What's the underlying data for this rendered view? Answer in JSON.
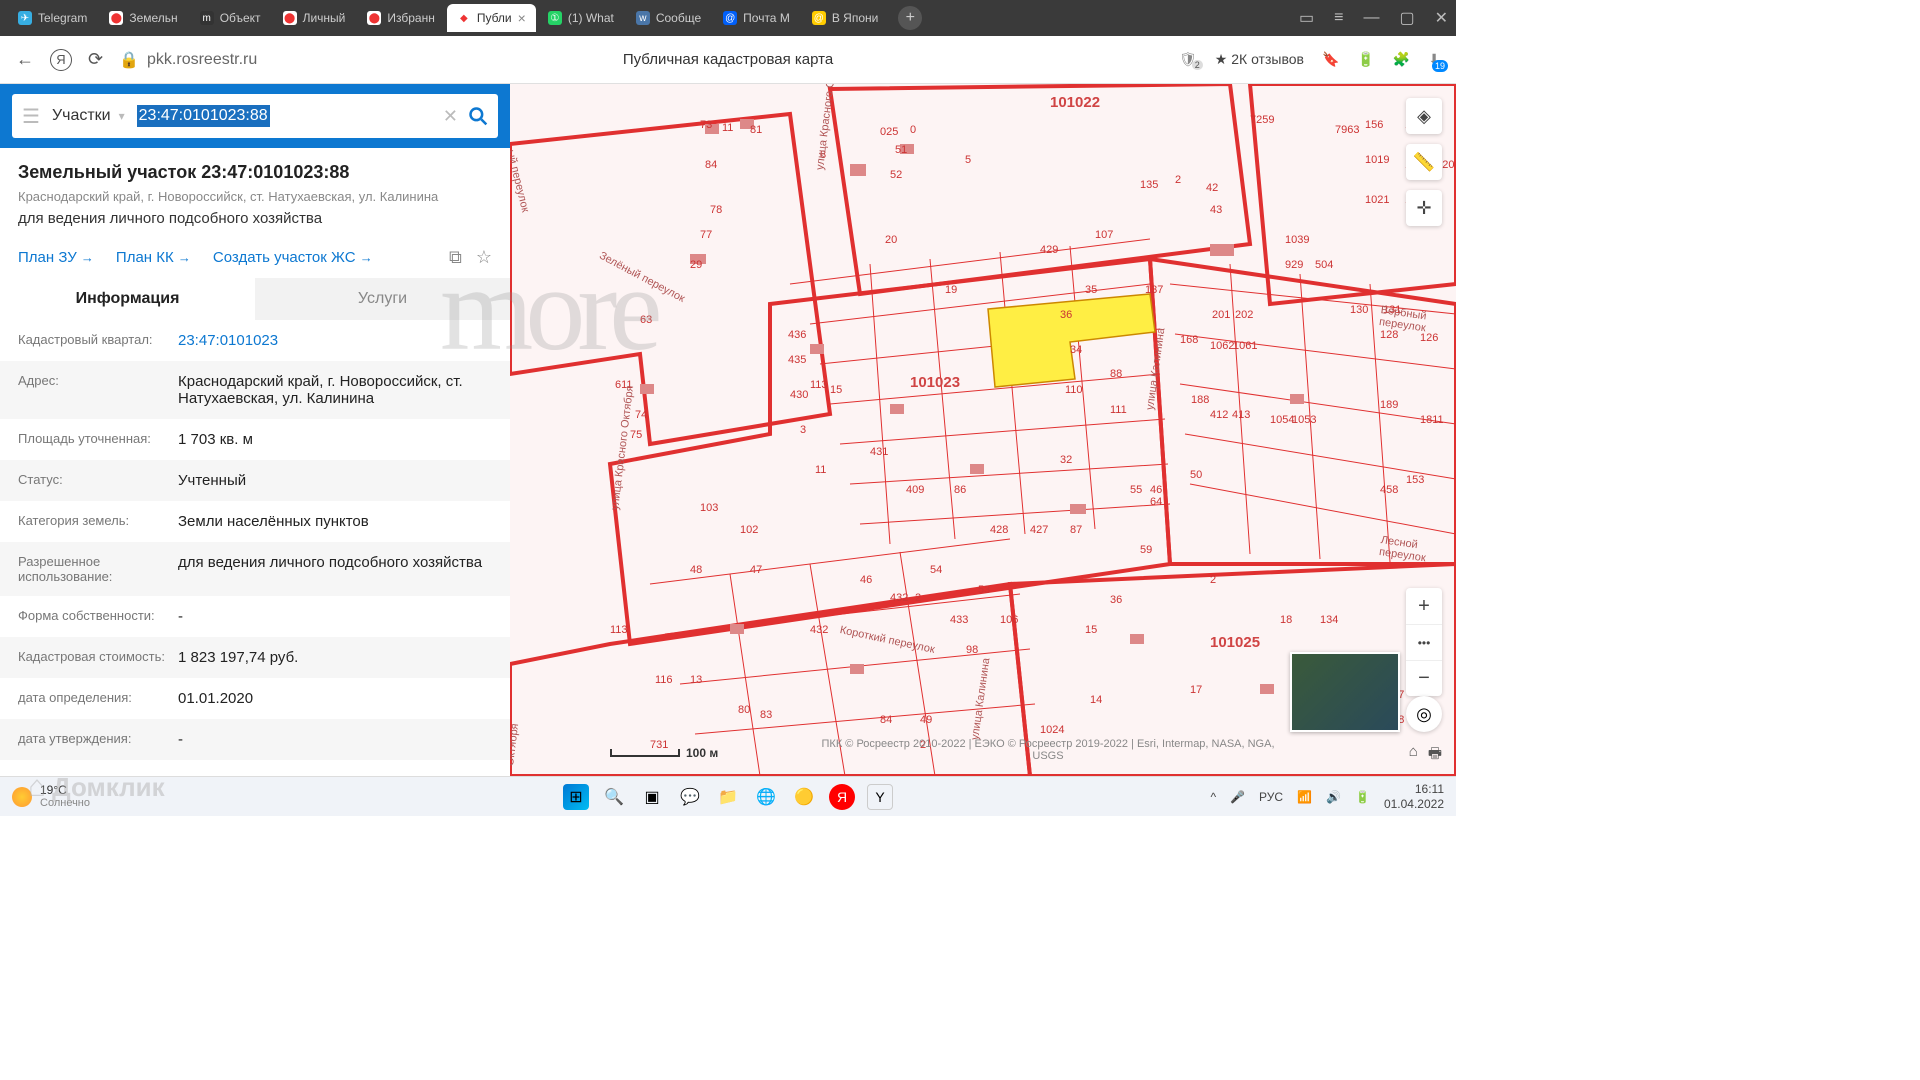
{
  "browser": {
    "tabs": [
      {
        "icon_bg": "#37aee2",
        "icon_text": "✈",
        "label": "Telegram"
      },
      {
        "icon_bg": "#fff",
        "icon_text": "⬤",
        "label": "Земельн"
      },
      {
        "icon_bg": "#333",
        "icon_text": "m",
        "label": "Объект"
      },
      {
        "icon_bg": "#fff",
        "icon_text": "⬤",
        "label": "Личный"
      },
      {
        "icon_bg": "#fff",
        "icon_text": "⬤",
        "label": "Избранн"
      },
      {
        "icon_bg": "#fff",
        "icon_text": "◆",
        "label": "Публи",
        "active": true
      },
      {
        "icon_bg": "#25d366",
        "icon_text": "①",
        "label": "(1) What"
      },
      {
        "icon_bg": "#4a76a8",
        "icon_text": "w",
        "label": "Сообще"
      },
      {
        "icon_bg": "#005ff9",
        "icon_text": "@",
        "label": "Почта М"
      },
      {
        "icon_bg": "#ffcc00",
        "icon_text": "@",
        "label": "В Япони"
      }
    ],
    "url": "pkk.rosreestr.ru",
    "page_title": "Публичная кадастровая карта",
    "reviews": "★ 2К отзывов",
    "notif_count": "2",
    "dl_count": "19"
  },
  "search": {
    "type_label": "Участки",
    "value": "23:47:0101023:88"
  },
  "parcel": {
    "title": "Земельный участок 23:47:0101023:88",
    "address_short": "Краснодарский край, г. Новороссийск, ст. Натухаевская, ул. Калинина",
    "use_short": "для ведения личного подсобного хозяйства",
    "actions": {
      "plan_zu": "План ЗУ",
      "plan_kk": "План КК",
      "create_zhs": "Создать участок ЖС"
    },
    "tabs": {
      "info": "Информация",
      "services": "Услуги"
    },
    "rows": [
      {
        "label": "Кадастровый квартал:",
        "value": "23:47:0101023",
        "link": true
      },
      {
        "label": "Адрес:",
        "value": "Краснодарский край, г. Новороссийск, ст. Натухаевская, ул. Калинина"
      },
      {
        "label": "Площадь уточненная:",
        "value": "1 703 кв. м"
      },
      {
        "label": "Статус:",
        "value": "Учтенный"
      },
      {
        "label": "Категория земель:",
        "value": "Земли населённых пунктов"
      },
      {
        "label": "Разрешенное использование:",
        "value": "для ведения личного подсобного хозяйства"
      },
      {
        "label": "Форма собственности:",
        "value": "-"
      },
      {
        "label": "Кадастровая стоимость:",
        "value": "1 823 197,74 руб."
      },
      {
        "label": "дата определения:",
        "value": "01.01.2020"
      },
      {
        "label": "дата утверждения:",
        "value": "-"
      }
    ]
  },
  "map": {
    "scale": "100 м",
    "attribution": "ПКК © Росреестр 2010-2022 | ЕЭКО © Росреестр 2019-2022 | Esri, Intermap, NASA, NGA, USGS",
    "blocks": [
      "101022",
      "101023",
      "101025"
    ],
    "streets": [
      "Зелёный переулок",
      "улица Красного Октября",
      "улица Калинина",
      "Короткий переулок",
      "Вербный переулок",
      "Лесной переулок"
    ],
    "highlighted_parcel": "88"
  },
  "watermark": "more",
  "domklik": "Домклик",
  "taskbar": {
    "temp": "19°C",
    "cond": "Солнечно",
    "lang": "РУС",
    "time": "16:11",
    "date": "01.04.2022"
  }
}
